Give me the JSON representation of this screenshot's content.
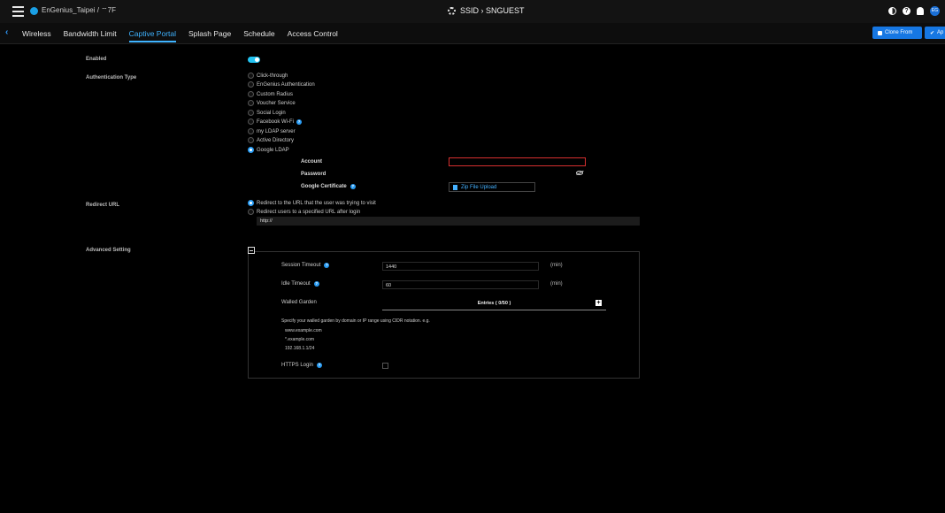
{
  "topbar": {
    "org": "EnGenius_Taipei / ⌔7F",
    "title": "SSID › SNGUEST",
    "avatar": "EG"
  },
  "tabs": [
    "Wireless",
    "Bandwidth Limit",
    "Captive Portal",
    "Splash Page",
    "Schedule",
    "Access Control"
  ],
  "active_tab": "Captive Portal",
  "buttons": {
    "clone": "Clone From",
    "apply": "Ap"
  },
  "form": {
    "enabled_label": "Enabled",
    "auth_label": "Authentication Type",
    "auth_options": [
      "Click-through",
      "EnGenius Authentication",
      "Custom Radius",
      "Voucher Service",
      "Social Login",
      "Facebook Wi-Fi",
      "my LDAP server",
      "Active Directory",
      "Google LDAP"
    ],
    "auth_selected": "Google LDAP",
    "account_label": "Account",
    "account_value": "",
    "password_label": "Password",
    "password_value": "",
    "cert_label": "Google Certificate",
    "upload_label": "Zip File Upload",
    "redirect_label": "Redirect URL",
    "redirect_options": [
      "Redirect to the URL that the user was trying to visit",
      "Redirect users to a specified URL after login"
    ],
    "redirect_selected": "Redirect to the URL that the user was trying to visit",
    "redirect_url": "http://",
    "advanced_label": "Advanced Setting"
  },
  "advanced": {
    "session_label": "Session Timeout",
    "session_value": "1440",
    "idle_label": "Idle Timeout",
    "idle_value": "60",
    "unit": "(min)",
    "walled_label": "Walled Garden",
    "entries": "Entries ( 0/50 )",
    "note": "Specify your walled garden by domain or IP range using CIDR notation. e.g.",
    "examples": [
      "www.example.com",
      "*.example.com",
      "192.168.1.1/24"
    ],
    "https_label": "HTTPS Login"
  },
  "colors": {
    "accent": "#2a9df4",
    "tab_active": "#3fb3ff",
    "toggle": "#23c4f2",
    "error": "#d62f2f"
  }
}
